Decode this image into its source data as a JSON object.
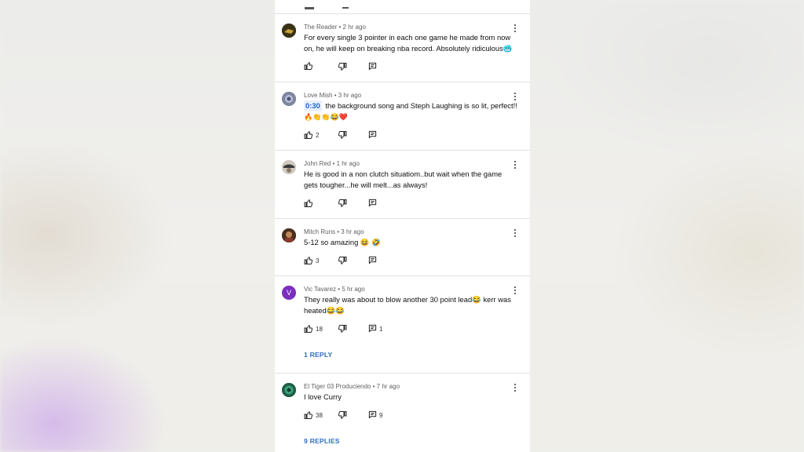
{
  "comments": [
    {
      "author": "The Reader",
      "age": "2 hr ago",
      "text": "For every single 3 pointer in each one game he made from now on, he will keep on breaking nba record. Absolutely ridiculous🥶",
      "likes": "",
      "replies": ""
    },
    {
      "author": "Love Mish",
      "age": "3 hr ago",
      "timestamp": "0:30",
      "text": "the background song and Steph Laughing is so lit, perfect!!",
      "emoji_line": "🔥👏👏😂❤️",
      "likes": "2",
      "replies": ""
    },
    {
      "author": "John Red",
      "age": "1 hr ago",
      "text": "He is good in a non clutch situatiom..but wait when the game gets tougher...he will melt...as always!",
      "likes": "",
      "replies": ""
    },
    {
      "author": "Mitch Runs",
      "age": "3 hr ago",
      "text": "5-12 so amazing 😆 🤣",
      "likes": "3",
      "replies": ""
    },
    {
      "author": "Vic Tavarez",
      "age": "5 hr ago",
      "avatar_letter": "V",
      "text": "They really was about to blow another 30 point lead😂 kerr was heated😂😂",
      "likes": "18",
      "replies": "1",
      "replies_link": "1 REPLY"
    },
    {
      "author": "El Tiger 03 Produciendo",
      "age": "7 hr ago",
      "text": "I love Curry",
      "likes": "38",
      "replies": "9",
      "replies_link": "9 REPLIES"
    }
  ],
  "separator": "•",
  "colors": {
    "accent": "#2e6fc4",
    "avatar_v": "#7b2fbf"
  },
  "icons": [
    "thumbs-up-icon",
    "thumbs-down-icon",
    "reply-icon",
    "more-vert-icon"
  ]
}
